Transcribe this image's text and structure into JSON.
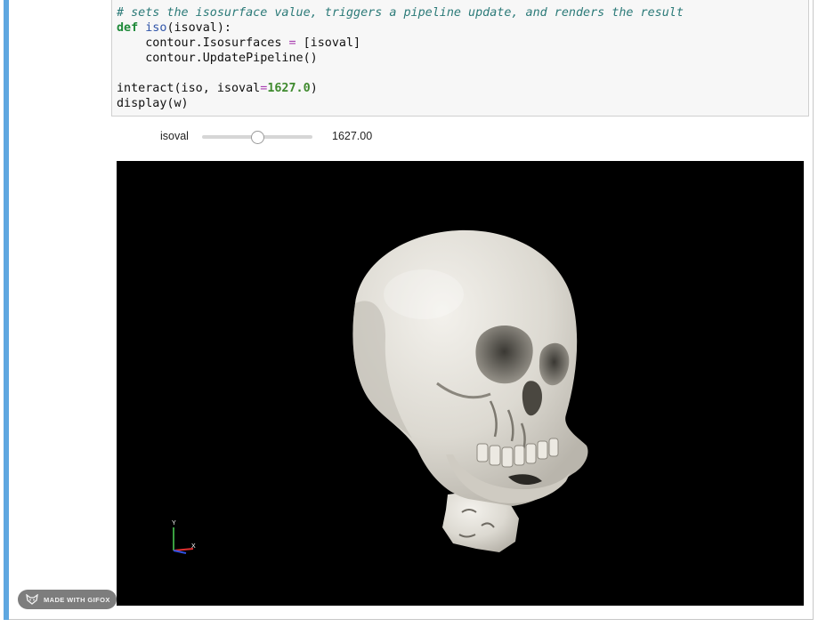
{
  "notebook": {
    "code_lines": {
      "comment": "# sets the isosurface value, triggers a pipeline update, and renders the result",
      "def_kw": "def",
      "func_name": "iso",
      "def_sig": "(isoval):",
      "line_isosurfaces_a": "contour.Isosurfaces ",
      "op_eq": "=",
      "line_isosurfaces_b": " [isoval]",
      "line_update": "contour.UpdatePipeline()",
      "interact_a": "interact(iso, isoval",
      "interact_num": "1627.0",
      "interact_b": ")",
      "display": "display(w)"
    }
  },
  "widget": {
    "label": "isoval",
    "value_text": "1627.00",
    "slider_fraction": 0.5
  },
  "viewport": {
    "axes": {
      "y_label": "Y",
      "x_label": "X"
    },
    "background": "#000000",
    "surface_color": "#e6e3dc"
  },
  "overlay": {
    "badge_text": "MADE WITH GIFOX",
    "badge_icon": "fox-icon"
  },
  "colors": {
    "cell_accent": "#5ea7e0",
    "axis_x": "#e03030",
    "axis_y": "#3aa040",
    "axis_z": "#3050e0"
  }
}
